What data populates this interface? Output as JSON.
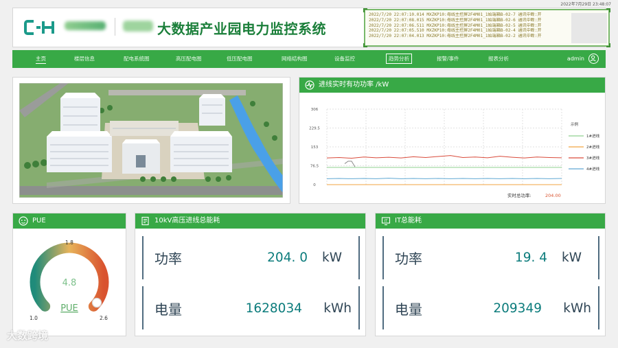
{
  "datetime": "2022年7月29日  23:48:07",
  "header": {
    "brand_text": "CH",
    "title": "大数据产业园电力监控系统"
  },
  "event_log": [
    "2022/7/20 22:07:10.014 MXZKP10:母线主控屏2F4M01_1始端箱B-02-7 通讯中断:开",
    "2022/7/20 22:07:08.015 MXZKP10:母线主控屏2F4M01_1始端箱B-02-6 通讯中断:开",
    "2022/7/20 22:07:06.511 MXZKP10:母线主控屏2F4M01_1始端箱B-02-5 通讯中断:开",
    "2022/7/20 22:07:05.510 MXZKP10:母线主控屏2F4M01_1始端箱B-02-4 通讯中断:开",
    "2022/7/20 22:07:04.013 MXZKP10:母线主控屏2F4M01_1始端箱B-02-2 通讯中断:开"
  ],
  "nav": {
    "items": [
      "主页",
      "楼层信息",
      "配电系统图",
      "高压配电图",
      "低压配电图",
      "网络结构图",
      "设备监控",
      "趋势分析",
      "报警/事件",
      "报表分析"
    ],
    "active": "主页",
    "boxed": "趋势分析",
    "user": "admin"
  },
  "icons": {
    "user": "user-circle-icon",
    "trend": "trend-line-icon",
    "pue": "gauge-face-icon",
    "energy": "document-list-icon",
    "it": "it-monitor-icon"
  },
  "colors": {
    "primary_green": "#38a946",
    "title_green": "#1b7f3a",
    "value_teal": "#0c7c7c",
    "line_1": "#8fd18f",
    "line_2": "#f2a341",
    "line_3": "#d94a3a",
    "line_4": "#5fa8d3"
  },
  "trend_panel": {
    "title": "进线实时有功功率  /kW",
    "legend_title": "示例",
    "total_label": "实时总功率:",
    "total_value": "204.00"
  },
  "chart_data": {
    "type": "line",
    "y_ticks": [
      "306",
      "229.5",
      "153",
      "76.5",
      "0"
    ],
    "ylim": [
      0,
      306
    ],
    "grid": true,
    "legend_position": "right",
    "series": [
      {
        "name": "1#进线",
        "color": "#8fd18f",
        "values": [
          70,
          70,
          70,
          70,
          70,
          70,
          70,
          70,
          70,
          70,
          70,
          70,
          70,
          70,
          70,
          70,
          70,
          70,
          70,
          70
        ]
      },
      {
        "name": "2#进线",
        "color": "#f2a341",
        "values": [
          0,
          0,
          0,
          0,
          0,
          0,
          0,
          0,
          0,
          0,
          0,
          0,
          0,
          0,
          0,
          0,
          0,
          0,
          0,
          0
        ]
      },
      {
        "name": "3#进线",
        "color": "#d94a3a",
        "values": [
          108,
          110,
          107,
          112,
          109,
          111,
          108,
          113,
          110,
          114,
          118,
          110,
          112,
          109,
          115,
          111,
          108,
          112,
          110,
          109
        ]
      },
      {
        "name": "4#进线",
        "color": "#5fa8d3",
        "values": [
          24,
          25,
          24,
          25,
          24,
          26,
          24,
          25,
          24,
          25,
          24,
          25,
          24,
          25,
          24,
          25,
          24,
          25,
          24,
          25
        ]
      }
    ],
    "early_spike": [
      85,
      95,
      95,
      72
    ]
  },
  "pue_panel": {
    "title": "PUE",
    "value": "4.8",
    "min": "1.0",
    "mid": "1.8",
    "max": "2.6",
    "caption": "PUE",
    "level_fraction": 0.97
  },
  "hv_panel": {
    "title": "10kV高压进线总能耗",
    "power_label": "功率",
    "power_value": "204. 0",
    "power_unit": "kW",
    "energy_label": "电量",
    "energy_value": "1628034",
    "energy_unit": "kWh"
  },
  "it_panel": {
    "title": "IT总能耗",
    "power_label": "功率",
    "power_value": "19. 4",
    "power_unit": "kW",
    "energy_label": "电量",
    "energy_value": "209349",
    "energy_unit": "kWh"
  },
  "watermark": "大数跨境"
}
